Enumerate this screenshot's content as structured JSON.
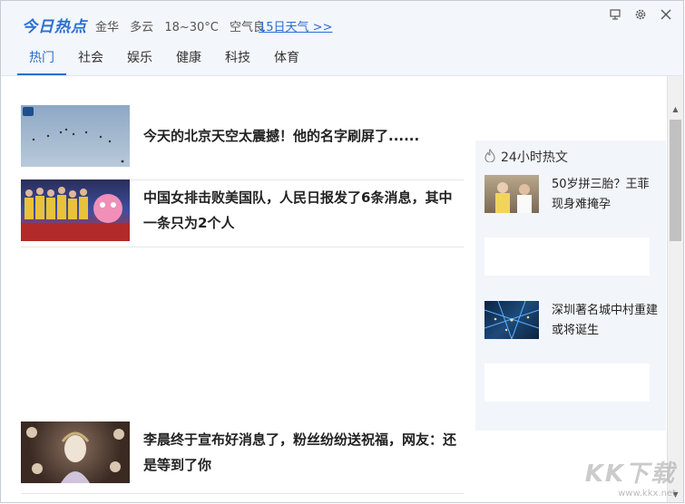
{
  "app": {
    "logo": "今日热点",
    "weather": {
      "city": "金华",
      "condition": "多云",
      "temperature": "18~30°C",
      "air": "空气良",
      "forecast_link": "15日天气 >>"
    },
    "window_icons": [
      "screen-icon",
      "settings-icon",
      "close-icon"
    ]
  },
  "tabs": [
    {
      "label": "热门",
      "active": true
    },
    {
      "label": "社会",
      "active": false
    },
    {
      "label": "娱乐",
      "active": false
    },
    {
      "label": "健康",
      "active": false
    },
    {
      "label": "科技",
      "active": false
    },
    {
      "label": "体育",
      "active": false
    }
  ],
  "news": [
    {
      "title": "今天的北京天空太震撼！他的名字刷屏了......"
    },
    {
      "title": "中国女排击败美国队，人民日报发了6条消息，其中一条只为2个人"
    },
    {
      "title": "李晨终于宣布好消息了，粉丝纷纷送祝福，网友：还是等到了你"
    }
  ],
  "sidebar": {
    "title": "24小时热文",
    "items": [
      {
        "title": "50岁拼三胎？王菲现身难掩孕"
      },
      {
        "title": "深圳著名城中村重建 或将诞生"
      }
    ]
  },
  "watermark": {
    "brand": "KK下载",
    "url": "www.kkx.net"
  },
  "colors": {
    "accent": "#2b6ed2",
    "header_bg": "#f3f6fa",
    "sidebar_bg": "#f2f5f9"
  }
}
